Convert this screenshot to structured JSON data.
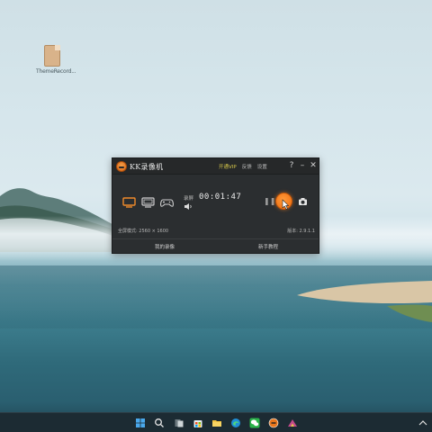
{
  "desktop": {
    "icon_label": "ThemeRecord..."
  },
  "window": {
    "title": "KK录像机",
    "links": {
      "open": "开通VIP",
      "feedback": "反馈",
      "settings": "设置"
    },
    "help": "?",
    "minimize": "–",
    "close": "✕",
    "record_label": "录屏",
    "timer": "00:01:47",
    "pause": "❚❚",
    "mode_info": "全屏模式: 2560 × 1600",
    "version": "版本: 2.9.1.1",
    "records_link": "我的录像",
    "tutorial_link": "新手教程"
  },
  "colors": {
    "accent_orange": "#ee6a0c",
    "vip_yellow": "#d6c74a",
    "window_bg": "#2b2e30",
    "taskbar_bg": "#1c2b33"
  }
}
